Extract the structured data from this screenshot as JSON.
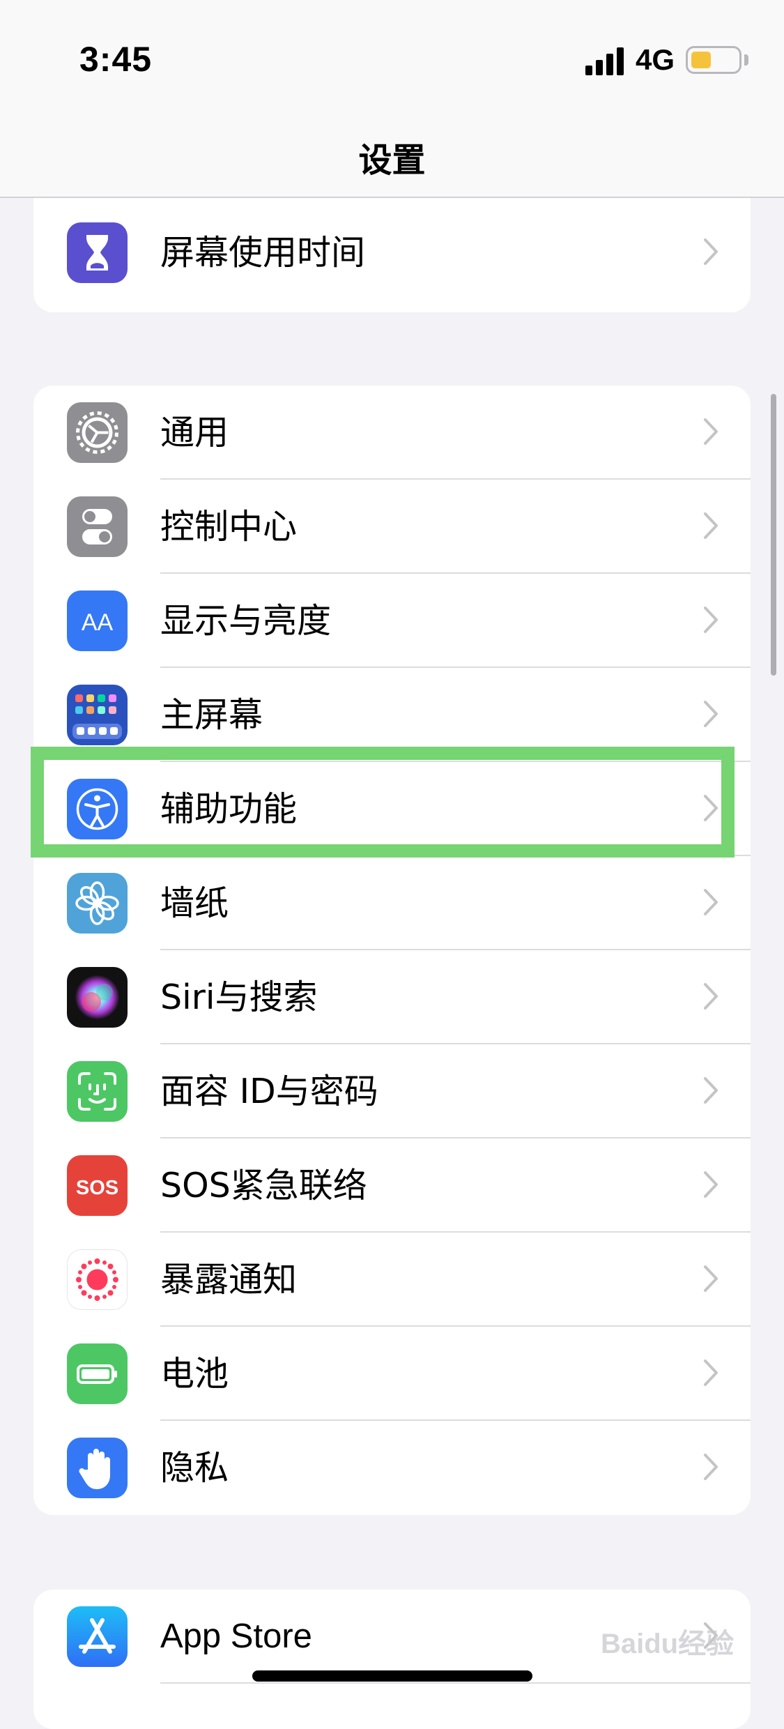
{
  "status_bar": {
    "time": "3:45",
    "network": "4G",
    "battery_color": "#f5c33b"
  },
  "nav": {
    "title": "设置"
  },
  "group1": [
    {
      "label": "屏幕使用时间",
      "icon": "hourglass-icon",
      "color": "#5a4fcf"
    }
  ],
  "group2": [
    {
      "label": "通用",
      "icon": "gear-icon",
      "color": "#8e8e93"
    },
    {
      "label": "控制中心",
      "icon": "toggles-icon",
      "color": "#8e8e93"
    },
    {
      "label": "显示与亮度",
      "icon": "text-size-icon",
      "color": "#3478f6"
    },
    {
      "label": "主屏幕",
      "icon": "home-grid-icon",
      "color": "#2a52be"
    },
    {
      "label": "辅助功能",
      "icon": "accessibility-icon",
      "color": "#3478f6"
    },
    {
      "label": "墙纸",
      "icon": "flower-icon",
      "color": "#4fa3d9"
    },
    {
      "label": "Siri与搜索",
      "icon": "siri-icon",
      "color": "#1c1c1e"
    },
    {
      "label": "面容 ID与密码",
      "icon": "face-id-icon",
      "color": "#4cc764"
    },
    {
      "label": "SOS紧急联络",
      "icon": "sos-icon",
      "color": "#e5433a"
    },
    {
      "label": "暴露通知",
      "icon": "exposure-icon",
      "color": "#ffffff"
    },
    {
      "label": "电池",
      "icon": "battery-icon",
      "color": "#4cc764"
    },
    {
      "label": "隐私",
      "icon": "hand-icon",
      "color": "#3478f6"
    }
  ],
  "group3": [
    {
      "label": "App Store",
      "icon": "app-store-icon",
      "color": "#2f8df7"
    }
  ],
  "highlighted_item": "辅助功能",
  "highlight_color": "#76d472",
  "watermark": "Baidu经验"
}
